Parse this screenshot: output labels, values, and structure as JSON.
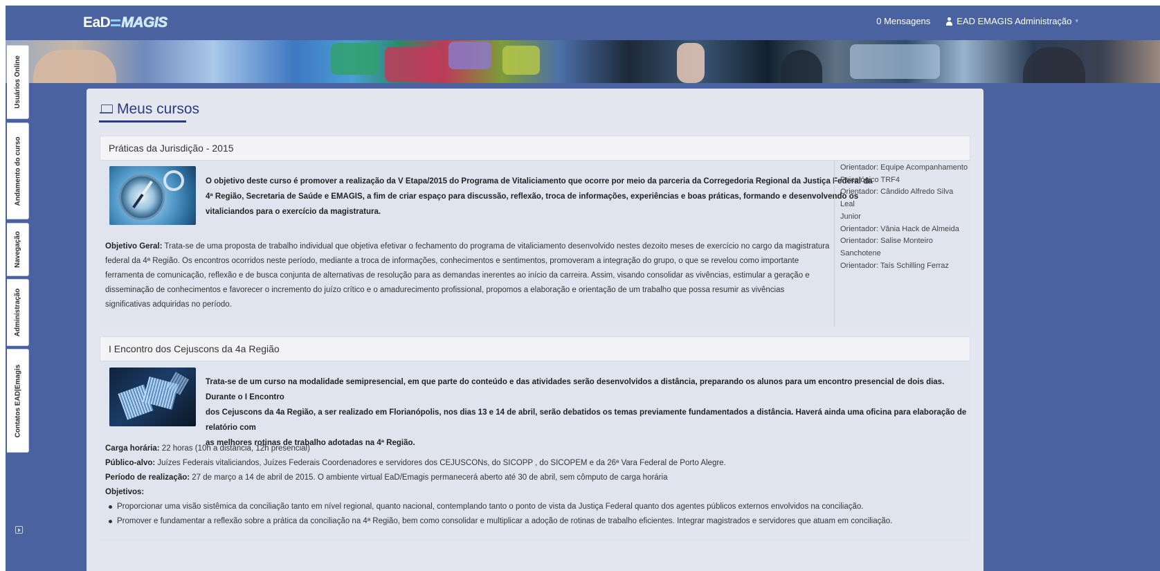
{
  "app": {
    "logo_text": "EaD EMAGIS",
    "logo_part1": "EaD",
    "logo_part2": "MAGIS"
  },
  "topbar": {
    "messages": "0 Mensagens",
    "user_name": "EAD EMAGIS Administração",
    "user_icon": "user-icon",
    "caret_icon": "caret-down-icon"
  },
  "sidebar": {
    "tabs": [
      {
        "label": "Usuários Online"
      },
      {
        "label": "Andamento do curso"
      },
      {
        "label": "Navegação"
      },
      {
        "label": "Administração"
      },
      {
        "label": "Contatos EAD|Emagis"
      }
    ]
  },
  "page": {
    "title": "Meus cursos",
    "title_icon": "laptop-icon"
  },
  "courses": [
    {
      "name": "Práticas da Jurisdição - 2015",
      "image": "compass-image",
      "summary_lines": [
        "O objetivo deste curso é promover a realização da V Etapa/2015 do Programa de Vitaliciamento que ocorre por meio da parceria da Corregedoria Regional da Justiça Federal da",
        "4ª Região, Secretaria de Saúde e EMAGIS, a fim de criar espaço para discussão, reflexão, troca de informações, experiências e boas práticas, formando e desenvolvendo os",
        "vitaliciandos para o exercício da magistratura."
      ],
      "objective_label": "Objetivo Geral:",
      "objective_lines": [
        " Trata-se de uma proposta de trabalho individual que objetiva efetivar o fechamento do programa de vitaliciamento desenvolvido nestes dezoito meses de exercício no cargo da magistratura",
        "federal da 4ª Região. Os encontros ocorridos neste período, mediante a troca de informações, conhecimentos e sentimentos, promoveram a integração do grupo, o que se revelou como importante",
        "ferramenta de comunicação, reflexão e de busca conjunta de alternativas de resolução para as demandas inerentes ao início da carreira. Assim, visando consolidar as vivências, estimular a geração e",
        "disseminação de conhecimentos e favorecer o incremento do juízo crítico e o amadurecimento profissional, propomos a elaboração e orientação de um trabalho que possa resumir as vivências",
        "significativas adquiridas no período."
      ],
      "teachers": [
        "Orientador: Equipe Acompanhamento",
        "Psicológico TRF4",
        "Orientador: Cândido Alfredo Silva Leal",
        "Junior",
        "Orientador: Vânia Hack de Almeida",
        "Orientador: Salise Monteiro",
        "Sanchotene",
        "Orientador: Taís Schilling Ferraz"
      ]
    },
    {
      "name": "I Encontro dos Cejuscons da 4a Região",
      "image": "handshake-image",
      "summary_lines": [
        "Trata-se de um curso na modalidade semipresencial, em que parte do conteúdo e das atividades serão desenvolvidos a distância, preparando os alunos para um encontro presencial de dois dias. Durante o I Encontro",
        "dos Cejuscons da 4a Região, a ser realizado em Florianópolis, nos dias 13 e 14 de abril, serão debatidos os temas previamente fundamentados a distância. Haverá ainda uma oficina para elaboração de relatório com",
        "as melhores rotinas de trabalho adotadas na 4ª Região."
      ],
      "details": [
        {
          "label": "Carga horária:",
          "value": " 22 horas (10h a distância, 12h presencial)"
        },
        {
          "label": "Público-alvo:",
          "value": " Juízes Federais vitaliciandos, Juízes Federais Coordenadores e servidores dos CEJUSCONs, do SICOPP , do SICOPEM e da 26ª Vara Federal de Porto Alegre."
        },
        {
          "label": "Período de realização:",
          "value": " 27 de março a 14 de abril de 2015. O ambiente virtual EaD/Emagis permanecerá aberto até 30 de abril, sem cômputo de carga horária"
        }
      ],
      "objectives_label": "Objetivos:",
      "objectives": [
        "Proporcionar uma visão sistêmica da conciliação tanto em nível regional, quanto nacional, contemplando tanto o ponto de vista da Justiça Federal quanto dos agentes públicos externos envolvidos na conciliação.",
        "Promover e fundamentar a reflexão sobre a prática da conciliação na 4ª Região, bem como consolidar e multiplicar a adoção de rotinas de trabalho eficientes. Integrar magistrados e servidores que atuam em conciliação."
      ]
    }
  ],
  "colors": {
    "primary": "#4a62a0",
    "panel": "#e4e7ef",
    "title": "#2b3a87"
  }
}
